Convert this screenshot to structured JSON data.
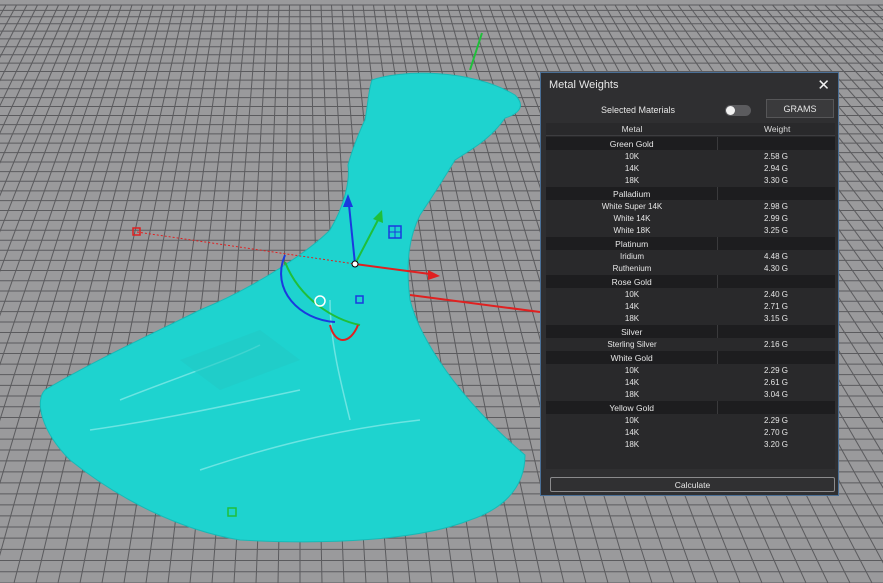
{
  "panel": {
    "title": "Metal Weights",
    "selected_label": "Selected Materials",
    "unit_button": "GRAMS",
    "calculate_label": "Calculate",
    "columns": [
      "Metal",
      "Weight"
    ],
    "groups": [
      {
        "name": "Green Gold",
        "items": [
          {
            "metal": "10K",
            "weight": "2.58 G"
          },
          {
            "metal": "14K",
            "weight": "2.94 G"
          },
          {
            "metal": "18K",
            "weight": "3.30 G"
          }
        ]
      },
      {
        "name": "Palladium",
        "items": [
          {
            "metal": "White Super 14K",
            "weight": "2.98 G"
          },
          {
            "metal": "White 14K",
            "weight": "2.99 G"
          },
          {
            "metal": "White 18K",
            "weight": "3.25 G"
          }
        ]
      },
      {
        "name": "Platinum",
        "items": [
          {
            "metal": "Iridium",
            "weight": "4.48 G"
          },
          {
            "metal": "Ruthenium",
            "weight": "4.30 G"
          }
        ]
      },
      {
        "name": "Rose Gold",
        "items": [
          {
            "metal": "10K",
            "weight": "2.40 G"
          },
          {
            "metal": "14K",
            "weight": "2.71 G"
          },
          {
            "metal": "18K",
            "weight": "3.15 G"
          }
        ]
      },
      {
        "name": "Silver",
        "items": [
          {
            "metal": "Sterling Silver",
            "weight": "2.16 G"
          }
        ]
      },
      {
        "name": "White Gold",
        "items": [
          {
            "metal": "10K",
            "weight": "2.29 G"
          },
          {
            "metal": "14K",
            "weight": "2.61 G"
          },
          {
            "metal": "18K",
            "weight": "3.04 G"
          }
        ]
      },
      {
        "name": "Yellow Gold",
        "items": [
          {
            "metal": "10K",
            "weight": "2.29 G"
          },
          {
            "metal": "14K",
            "weight": "2.70 G"
          },
          {
            "metal": "18K",
            "weight": "3.20 G"
          }
        ]
      }
    ]
  },
  "viewport": {
    "icons": [
      "move-gizmo-icon",
      "rotate-gizmo-icon"
    ],
    "colors": {
      "model": "#1ed3cf",
      "grid": "#5b5b5e",
      "background": "#9a9a9c",
      "axis_x": "#e02020",
      "axis_y": "#1fbf3a",
      "axis_z": "#1a3adf"
    }
  }
}
